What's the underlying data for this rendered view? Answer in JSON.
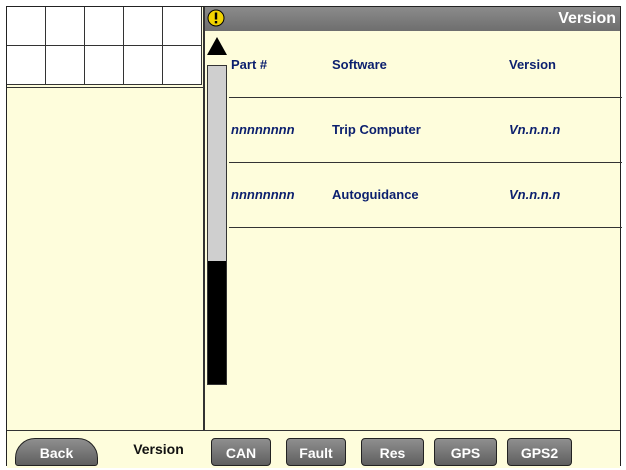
{
  "header": {
    "title": "Version",
    "warning_icon": "warning-icon"
  },
  "table": {
    "headers": [
      "Part #",
      "Software",
      "Version"
    ],
    "rows": [
      [
        "nnnnnnnn",
        "Trip Computer",
        "Vn.n.n.n"
      ],
      [
        "nnnnnnnn",
        "Autoguidance",
        "Vn.n.n.n"
      ]
    ]
  },
  "scroll": {
    "up_icon": "up-arrow-icon"
  },
  "tabs": {
    "back": "Back",
    "version": "Version",
    "can": "CAN",
    "fault": "Fault",
    "res": "Res",
    "gps": "GPS",
    "gps2": "GPS2"
  }
}
